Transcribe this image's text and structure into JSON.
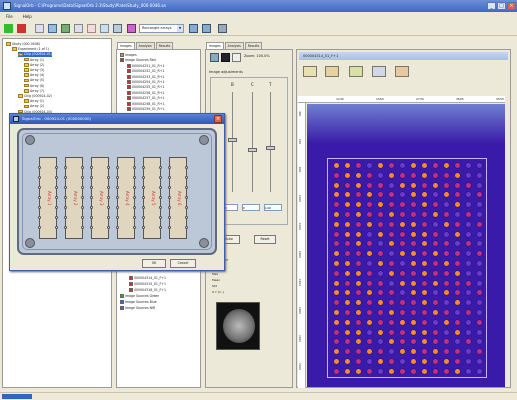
{
  "window": {
    "title": "SignalOrb - C:\\Programs\\Data\\SignalOrb 2.3\\Study\\Plate\\Study_000-0046.sa"
  },
  "menu": [
    "File",
    "Help"
  ],
  "toolbar": {
    "combo_value": "Rectangle arrays"
  },
  "tree": {
    "items": [
      {
        "label": "Study (000-0046)",
        "type": "folder"
      },
      {
        "label": "Experiment (1 of 1)",
        "type": "folder"
      },
      {
        "label": "Chip (000924-01)",
        "type": "folder",
        "selected": true
      },
      {
        "label": "Array (1)",
        "type": "folder"
      },
      {
        "label": "Array (2)",
        "type": "folder"
      },
      {
        "label": "Array (3)",
        "type": "folder"
      },
      {
        "label": "Array (4)",
        "type": "folder"
      },
      {
        "label": "Array (5)",
        "type": "folder"
      },
      {
        "label": "Array (6)",
        "type": "folder"
      },
      {
        "label": "Array (7)",
        "type": "folder"
      },
      {
        "label": "Chip (000924-02)",
        "type": "folder"
      },
      {
        "label": "Array (1)",
        "type": "folder"
      },
      {
        "label": "Array (2)",
        "type": "folder"
      },
      {
        "label": "Chip (000924-03)",
        "type": "folder"
      }
    ]
  },
  "images_panel": {
    "tabs": [
      "Images",
      "Analysis",
      "Results"
    ],
    "items": [
      {
        "label": "Images",
        "color": "#c9a227"
      },
      {
        "label": "Image Sources Red",
        "color": "#d23030"
      },
      {
        "label": "000004251_01_R+1",
        "color": "#d23030"
      },
      {
        "label": "000004252_01_R+1",
        "color": "#d23030"
      },
      {
        "label": "000004253_01_R+1",
        "color": "#d23030"
      },
      {
        "label": "000004254_01_R+1",
        "color": "#d23030"
      },
      {
        "label": "000004255_01_R+1",
        "color": "#d23030"
      },
      {
        "label": "000004256_01_R+1",
        "color": "#d23030"
      },
      {
        "label": "000004257_01_R+1",
        "color": "#d23030"
      },
      {
        "label": "000004258_01_R+1",
        "color": "#d23030"
      },
      {
        "label": "000004259_01_R+1",
        "color": "#d23030"
      }
    ],
    "bottom_items": [
      {
        "label": "000004314_01_F+1",
        "color": "#d23030"
      },
      {
        "label": "000004315_01_F+1",
        "color": "#d23030"
      },
      {
        "label": "000004316_01_F+1",
        "color": "#d23030"
      },
      {
        "label": "Image Sources Green",
        "color": "#2fa83a"
      },
      {
        "label": "Image Sources Blue",
        "color": "#3a5fd0"
      },
      {
        "label": "Image Sources NIR",
        "color": "#8a3fb5"
      }
    ]
  },
  "adjust_panel": {
    "tabs": [
      "Images",
      "Analysis",
      "Results"
    ],
    "zoom": "Zoom: 100.0%",
    "section": "Image adjustments",
    "slider_labels": [
      "B",
      "C",
      "T"
    ],
    "field_values": [
      "0.76",
      "0",
      "1.00"
    ],
    "auto_label": "Auto",
    "reset_label": "Reset",
    "info_header": "Info layer",
    "info_rows": [
      "Min",
      "Max",
      "Mean",
      "Std",
      "X  Y  (1..)"
    ]
  },
  "image_view": {
    "title": "000004314_01_F+1",
    "ruler_h": [
      "1240",
      "1560",
      "2730",
      "3605",
      "4530"
    ],
    "ruler_v": [
      "400",
      "600",
      "800",
      "1000",
      "1200",
      "1400",
      "1600",
      "1800",
      "2000",
      "2200"
    ]
  },
  "dialog": {
    "title": "SignalOrb - 000924-01 (000000000)",
    "chip_labels": [
      "Array 1",
      "Array 2",
      "Array 3",
      "Array 4",
      "Array 5",
      "Array 6"
    ],
    "ok_label": "OK",
    "cancel_label": "Cancel"
  },
  "colors": {
    "plate_bg": "#3a1aa8",
    "spot_hot": "#ff8a2a",
    "spot_mid": "#c4307a",
    "spot_cool": "#6b3cc9"
  }
}
